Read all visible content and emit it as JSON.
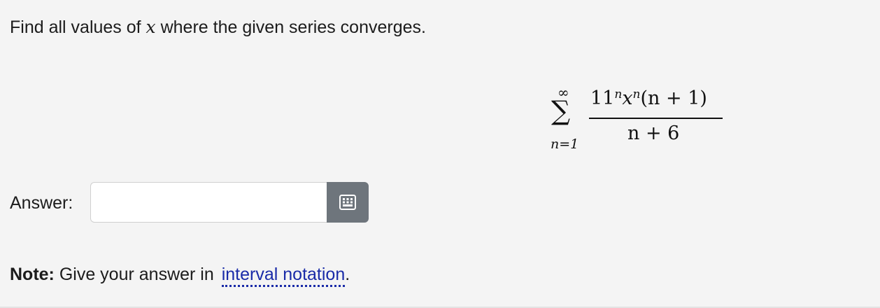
{
  "question": {
    "prefix": "Find all values of ",
    "variable": "x",
    "suffix": " where the given series converges."
  },
  "formula": {
    "sum_upper": "∞",
    "sum_symbol": "∑",
    "sum_lower": "n=1",
    "numerator": {
      "base": "11",
      "base_exp": "n",
      "var": "x",
      "var_exp": "n",
      "factor": "(n + 1)"
    },
    "denominator": "n + 6"
  },
  "answer": {
    "label": "Answer:",
    "value": "",
    "placeholder": ""
  },
  "keyboard_button": {
    "icon": "keyboard-grid-icon"
  },
  "note": {
    "bold": "Note:",
    "text": " Give your answer in ",
    "link": "interval notation",
    "end": "."
  }
}
